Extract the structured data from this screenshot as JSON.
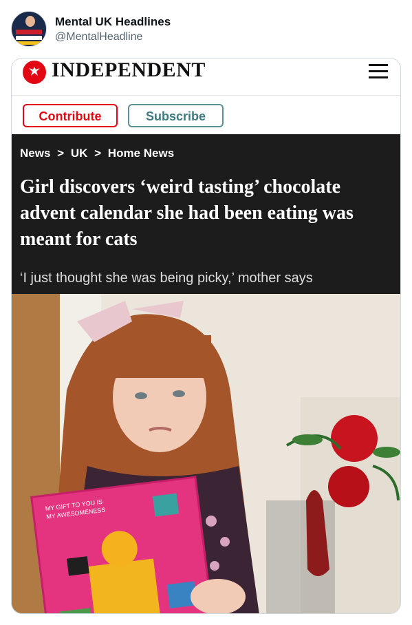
{
  "tweet": {
    "display_name": "Mental UK Headlines",
    "handle": "@MentalHeadline",
    "avatar_text": "THE UK IS MENTAL"
  },
  "article": {
    "publisher": "INDEPENDENT",
    "buttons": {
      "contribute": "Contribute",
      "subscribe": "Subscribe"
    },
    "breadcrumb": [
      "News",
      ">",
      "UK",
      ">",
      "Home News"
    ],
    "headline": "Girl discovers ‘weird tasting’ chocolate advent calendar she had been eating was meant for cats",
    "standfirst": "‘I just thought she was being picky,’ mother says",
    "calendar_text": [
      "MY GIFT TO YOU IS",
      "MY AWESOMENESS"
    ]
  },
  "colors": {
    "brand_red": "#e30613",
    "subscribe_teal": "#3c7a82",
    "dark_panel": "#1c1c1c"
  },
  "icons": {
    "menu": "hamburger-icon",
    "logo": "eagle-icon"
  }
}
